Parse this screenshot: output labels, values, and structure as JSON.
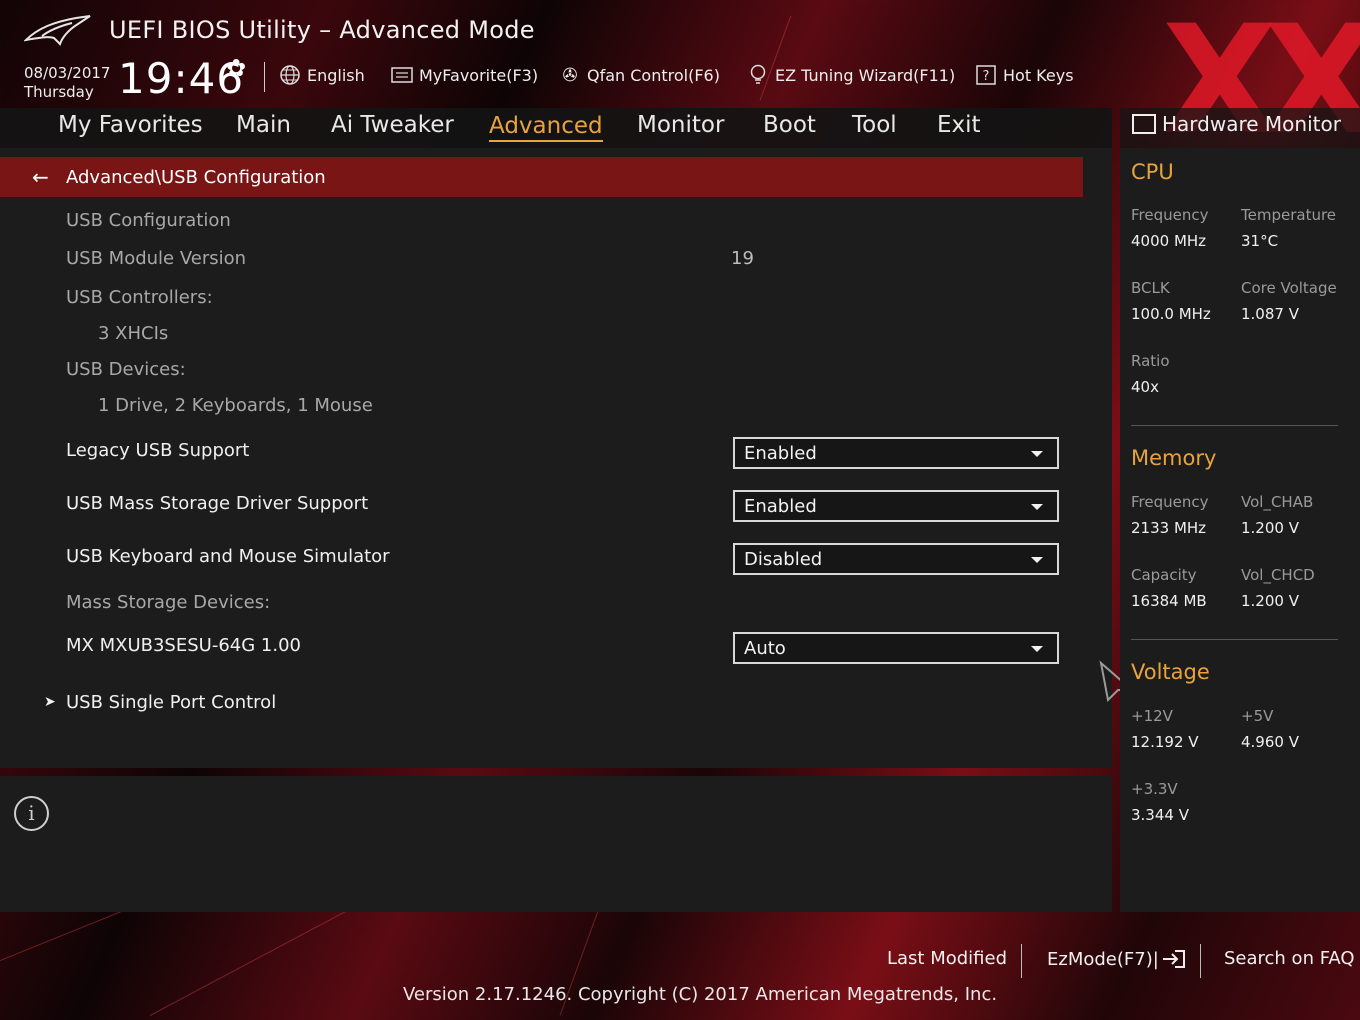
{
  "header": {
    "title": "UEFI BIOS Utility – Advanced Mode",
    "date": "08/03/2017",
    "weekday": "Thursday",
    "time": "19:46",
    "tools": {
      "language": "English",
      "my_favorite": "MyFavorite(F3)",
      "qfan": "Qfan Control(F6)",
      "ez_tuning": "EZ Tuning Wizard(F11)",
      "hot_keys": "Hot Keys"
    },
    "watermark": "XX"
  },
  "menu": {
    "items": [
      "My Favorites",
      "Main",
      "Ai Tweaker",
      "Advanced",
      "Monitor",
      "Boot",
      "Tool",
      "Exit"
    ],
    "active": "Advanced"
  },
  "main": {
    "breadcrumb": "Advanced\\USB Configuration",
    "usb_configuration": "USB Configuration",
    "usb_module_version_label": "USB Module Version",
    "usb_module_version_value": "19",
    "usb_controllers_label": "USB Controllers:",
    "usb_controllers_value": "3 XHCIs",
    "usb_devices_label": "USB Devices:",
    "usb_devices_value": "1 Drive, 2 Keyboards, 1 Mouse",
    "legacy_usb_label": "Legacy USB Support",
    "legacy_usb_value": "Enabled",
    "mass_storage_driver_label": "USB Mass Storage Driver Support",
    "mass_storage_driver_value": "Enabled",
    "kbd_mouse_sim_label": "USB Keyboard and Mouse Simulator",
    "kbd_mouse_sim_value": "Disabled",
    "mass_storage_devices_label": "Mass Storage Devices:",
    "device_name": "MX MXUB3SESU-64G 1.00",
    "device_value": "Auto",
    "single_port_control": "USB Single Port Control"
  },
  "hardware_monitor": {
    "title": "Hardware Monitor",
    "cpu": {
      "heading": "CPU",
      "frequency_label": "Frequency",
      "frequency": "4000 MHz",
      "temperature_label": "Temperature",
      "temperature": "31°C",
      "bclk_label": "BCLK",
      "bclk": "100.0 MHz",
      "core_voltage_label": "Core Voltage",
      "core_voltage": "1.087 V",
      "ratio_label": "Ratio",
      "ratio": "40x"
    },
    "memory": {
      "heading": "Memory",
      "frequency_label": "Frequency",
      "frequency": "2133 MHz",
      "vol_chab_label": "Vol_CHAB",
      "vol_chab": "1.200 V",
      "capacity_label": "Capacity",
      "capacity": "16384 MB",
      "vol_chcd_label": "Vol_CHCD",
      "vol_chcd": "1.200 V"
    },
    "voltage": {
      "heading": "Voltage",
      "v12_label": "+12V",
      "v12": "12.192 V",
      "v5_label": "+5V",
      "v5": "4.960 V",
      "v33_label": "+3.3V",
      "v33": "3.344 V"
    }
  },
  "footer": {
    "last_modified": "Last Modified",
    "ezmode": "EzMode(F7)|",
    "search_faq": "Search on FAQ",
    "version": "Version 2.17.1246. Copyright (C) 2017 American Megatrends, Inc."
  },
  "colors": {
    "accent": "#e8a33d",
    "breadcrumb_bg": "#7a1515",
    "panel_bg": "#1c1c1c"
  }
}
